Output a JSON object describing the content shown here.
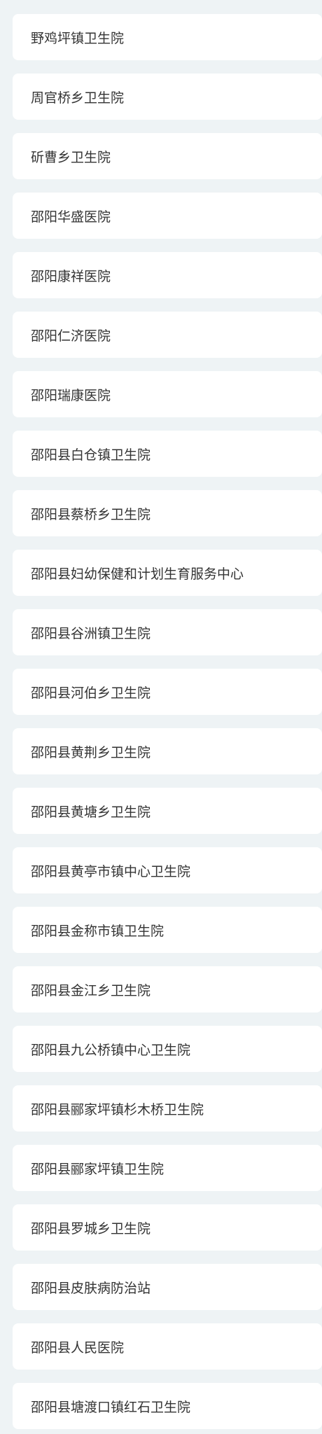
{
  "hospitals": [
    {
      "name": "野鸡坪镇卫生院"
    },
    {
      "name": "周官桥乡卫生院"
    },
    {
      "name": "斫曹乡卫生院"
    },
    {
      "name": "邵阳华盛医院"
    },
    {
      "name": "邵阳康祥医院"
    },
    {
      "name": "邵阳仁济医院"
    },
    {
      "name": "邵阳瑞康医院"
    },
    {
      "name": "邵阳县白仓镇卫生院"
    },
    {
      "name": "邵阳县蔡桥乡卫生院"
    },
    {
      "name": "邵阳县妇幼保健和计划生育服务中心"
    },
    {
      "name": "邵阳县谷洲镇卫生院"
    },
    {
      "name": "邵阳县河伯乡卫生院"
    },
    {
      "name": "邵阳县黄荆乡卫生院"
    },
    {
      "name": "邵阳县黄塘乡卫生院"
    },
    {
      "name": "邵阳县黄亭市镇中心卫生院"
    },
    {
      "name": "邵阳县金称市镇卫生院"
    },
    {
      "name": "邵阳县金江乡卫生院"
    },
    {
      "name": "邵阳县九公桥镇中心卫生院"
    },
    {
      "name": "邵阳县郦家坪镇杉木桥卫生院"
    },
    {
      "name": "邵阳县郦家坪镇卫生院"
    },
    {
      "name": "邵阳县罗城乡卫生院"
    },
    {
      "name": "邵阳县皮肤病防治站"
    },
    {
      "name": "邵阳县人民医院"
    },
    {
      "name": "邵阳县塘渡口镇红石卫生院"
    }
  ]
}
